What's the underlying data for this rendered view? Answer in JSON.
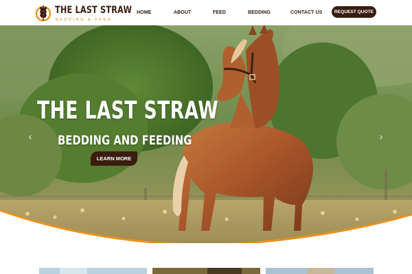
{
  "brand": {
    "title": "THE LAST STRAW",
    "subtitle": "BEDDING & FEED"
  },
  "nav": {
    "items": [
      {
        "label": "HOME"
      },
      {
        "label": "ABOUT"
      },
      {
        "label": "FEED"
      },
      {
        "label": "BEDDING"
      },
      {
        "label": "CONTACT US"
      }
    ],
    "cta_label": "REQUEST QUOTE"
  },
  "hero": {
    "title": "THE LAST STRAW",
    "subtitle": "BEDDING AND FEEDING",
    "button_label": "LEARN MORE",
    "prev_arrow": "‹",
    "next_arrow": "›"
  },
  "colors": {
    "brand_dark": "#3a1d0f",
    "accent_orange": "#e8921f",
    "background": "#ffffff"
  },
  "icons": {
    "logo": "wheat-icon",
    "prev": "chevron-left-icon",
    "next": "chevron-right-icon"
  }
}
